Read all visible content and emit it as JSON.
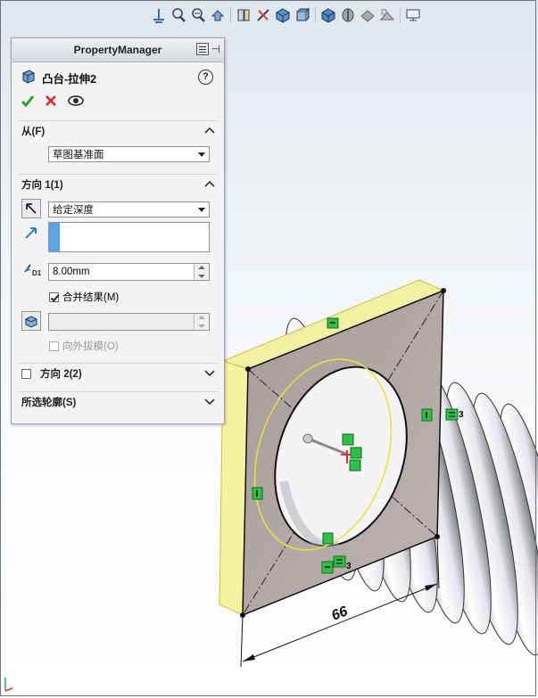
{
  "hud_icons": [
    "zoom-to-fit-icon",
    "zoom-area-icon",
    "zoom-in-out-icon",
    "previous-view-icon",
    "section-view-icon",
    "dynamic-annotation-icon",
    "view-orientation-icon",
    "display-style-icon",
    "hide-show-items-icon",
    "edit-appearance-icon",
    "apply-scene-icon",
    "view-settings-icon"
  ],
  "property_manager": {
    "title": "PropertyManager",
    "feature_name": "凸台-拉伸2",
    "help": "?",
    "from": {
      "label": "从(F)",
      "value": "草图基准面"
    },
    "direction1": {
      "label": "方向 1(1)",
      "end_condition": "给定深度",
      "depth": "8.00mm",
      "merge_result": "合并结果(M)",
      "merge_checked": true,
      "draft_outward": "向外拔模(O)",
      "draft_checked": false
    },
    "direction2": {
      "label": "方向 2(2)",
      "checked": false
    },
    "selected_contours": {
      "label": "所选轮廓(S)"
    }
  },
  "model": {
    "dimension_value": "66",
    "relation_count_a": "3",
    "relation_count_b": "3"
  },
  "colors": {
    "accent_blue": "#3d8ee0",
    "plate": "#b3aaa8",
    "sketch_yellow": "#e8e23a",
    "relation_green": "#2fbf4a"
  }
}
